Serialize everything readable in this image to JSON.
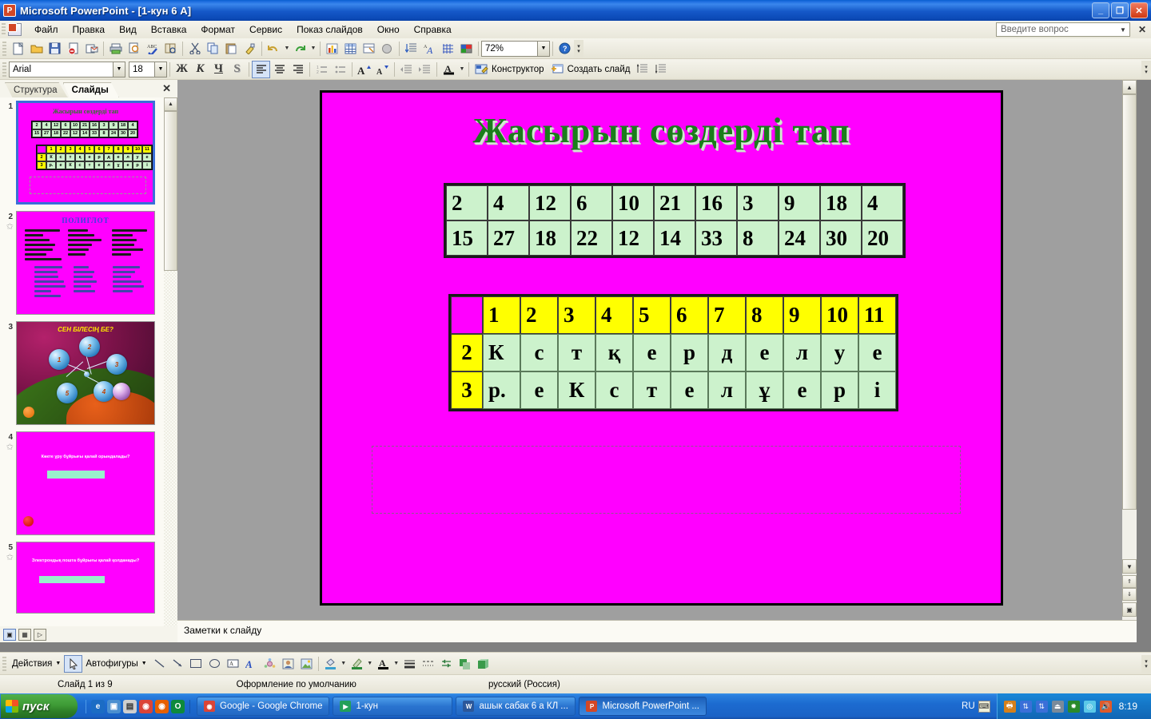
{
  "window": {
    "title": "Microsoft PowerPoint - [1-кун 6 А]",
    "app_icon": "powerpoint-icon",
    "minimize": "_",
    "restore": "❐",
    "close": "✕"
  },
  "menubar": {
    "items": [
      "Файл",
      "Правка",
      "Вид",
      "Вставка",
      "Формат",
      "Сервис",
      "Показ слайдов",
      "Окно",
      "Справка"
    ],
    "ask_placeholder": "Введите вопрос"
  },
  "standard_toolbar": {
    "buttons": [
      {
        "name": "new-document-icon",
        "glyph": "🗋"
      },
      {
        "name": "open-folder-icon",
        "glyph": "📂"
      },
      {
        "name": "save-icon",
        "glyph": "💾"
      },
      {
        "name": "permission-icon",
        "glyph": "🗎"
      },
      {
        "name": "email-icon",
        "glyph": "📧"
      },
      {
        "name": "print-icon",
        "glyph": "🖨"
      },
      {
        "name": "print-preview-icon",
        "glyph": "🔍"
      },
      {
        "name": "spelling-icon",
        "glyph": "ABC"
      },
      {
        "name": "research-icon",
        "glyph": "📖"
      },
      {
        "name": "cut-icon",
        "glyph": "✂"
      },
      {
        "name": "copy-icon",
        "glyph": "⧉"
      },
      {
        "name": "paste-icon",
        "glyph": "📋"
      },
      {
        "name": "format-painter-icon",
        "glyph": "🖌"
      },
      {
        "name": "undo-icon",
        "glyph": "↩"
      },
      {
        "name": "redo-icon",
        "glyph": "↪"
      },
      {
        "name": "insert-chart-icon",
        "glyph": "📊"
      },
      {
        "name": "insert-table-icon",
        "glyph": "▦"
      },
      {
        "name": "tables-borders-icon",
        "glyph": "▤"
      },
      {
        "name": "insert-hyperlink-icon",
        "glyph": "🌐"
      },
      {
        "name": "expand-all-icon",
        "glyph": "⇟"
      },
      {
        "name": "show-formatting-icon",
        "glyph": "A"
      },
      {
        "name": "show-grid-icon",
        "glyph": "▦"
      },
      {
        "name": "color-grayscale-icon",
        "glyph": "▨"
      }
    ],
    "zoom_value": "72%",
    "help_icon": "help-icon"
  },
  "formatting_toolbar": {
    "font_name": "Arial",
    "font_size": "18",
    "bold": "Ж",
    "italic": "К",
    "underline": "Ч",
    "shadow": "S",
    "align_left": "≡",
    "align_center": "≡",
    "align_right": "≡",
    "numbering": "≔",
    "bullets": "≔",
    "increase_font": "A",
    "decrease_font": "A",
    "decrease_indent": "⇤",
    "increase_indent": "⇥",
    "font_color": "A",
    "design_label": "Конструктор",
    "new_slide_label": "Создать слайд"
  },
  "task_pane": {
    "tab_outline": "Структура",
    "tab_slides": "Слайды",
    "active_tab": "Слайды",
    "close_icon": "close-icon",
    "slides": [
      {
        "number": "1",
        "selected": true,
        "has_star": false,
        "title": "Жасырын сөздерді тап"
      },
      {
        "number": "2",
        "selected": false,
        "has_star": true,
        "title": "ПОЛИГЛОТ"
      },
      {
        "number": "3",
        "selected": false,
        "has_star": false,
        "title": "СЕН БІЛЕСІҢ БЕ?"
      },
      {
        "number": "4",
        "selected": false,
        "has_star": true,
        "title": "Көкте ұру бұйрығы қалай орындалады?"
      },
      {
        "number": "5",
        "selected": false,
        "has_star": true,
        "title": "Электрондық пошта бұйрығы қалай қолданады?"
      }
    ]
  },
  "slide": {
    "title": "Жасырын сөздерді тап",
    "background_color": "#FF00FF",
    "title_color": "#1B7D1B",
    "number_table": {
      "cell_bg": "#CCF2CC",
      "rows": [
        [
          "2",
          "4",
          "12",
          "6",
          "10",
          "21",
          "16",
          "3",
          "9",
          "18",
          "4"
        ],
        [
          "15",
          "27",
          "18",
          "22",
          "12",
          "14",
          "33",
          "8",
          "24",
          "30",
          "20"
        ]
      ]
    },
    "letter_table": {
      "header_bg": "#FFFF00",
      "cell_bg": "#CCF2CC",
      "corner": "",
      "column_headers": [
        "1",
        "2",
        "3",
        "4",
        "5",
        "6",
        "7",
        "8",
        "9",
        "10",
        "11"
      ],
      "rows": [
        {
          "header": "2",
          "cells": [
            "К",
            "с",
            "т",
            "қ",
            "е",
            "р",
            "д",
            "е",
            "л",
            "у",
            "е"
          ]
        },
        {
          "header": "3",
          "cells": [
            "р.",
            "е",
            "К",
            "с",
            "т",
            "е",
            "л",
            "ұ",
            "е",
            "р",
            "і"
          ]
        }
      ]
    }
  },
  "notes": {
    "placeholder": "Заметки к слайду"
  },
  "drawing_toolbar": {
    "actions_label": "Действия",
    "autoshapes_label": "Автофигуры",
    "buttons": [
      {
        "name": "select-arrow-icon",
        "glyph": "↖"
      },
      {
        "name": "line-icon",
        "glyph": "╲"
      },
      {
        "name": "arrow-icon",
        "glyph": "↘"
      },
      {
        "name": "rectangle-icon",
        "glyph": "▭"
      },
      {
        "name": "oval-icon",
        "glyph": "◯"
      },
      {
        "name": "textbox-icon",
        "glyph": "A"
      },
      {
        "name": "wordart-icon",
        "glyph": "A"
      },
      {
        "name": "diagram-icon",
        "glyph": "❂"
      },
      {
        "name": "clipart-icon",
        "glyph": "▣"
      },
      {
        "name": "picture-icon",
        "glyph": "▨"
      },
      {
        "name": "fill-color-icon",
        "glyph": "🪣"
      },
      {
        "name": "line-color-icon",
        "glyph": "🖊"
      },
      {
        "name": "font-color-icon",
        "glyph": "A"
      },
      {
        "name": "line-style-icon",
        "glyph": "≡"
      },
      {
        "name": "dash-style-icon",
        "glyph": "┅"
      },
      {
        "name": "arrow-style-icon",
        "glyph": "⇄"
      },
      {
        "name": "shadow-style-icon",
        "glyph": "▪"
      },
      {
        "name": "3d-style-icon",
        "glyph": "▰"
      }
    ]
  },
  "statusbar": {
    "slide_counter": "Слайд 1 из 9",
    "design_name": "Оформление по умолчанию",
    "language": "русский (Россия)"
  },
  "taskbar": {
    "start_label": "пуск",
    "quick_launch": [
      {
        "name": "internet-explorer-icon",
        "glyph": "e",
        "color": "#1B6CC4"
      },
      {
        "name": "show-desktop-icon",
        "glyph": "▣",
        "color": "#4A8FD0"
      },
      {
        "name": "media-icon",
        "glyph": "▤",
        "color": "#C0C0C0"
      },
      {
        "name": "chrome-icon",
        "glyph": "◉",
        "color": "#DB4437"
      },
      {
        "name": "firefox-icon",
        "glyph": "◉",
        "color": "#E66000"
      },
      {
        "name": "opera-icon",
        "glyph": "O",
        "color": "#0E8A3C"
      }
    ],
    "tasks": [
      {
        "label": "Google - Google Chrome",
        "icon": "chrome-icon",
        "color": "#DB4437",
        "active": false
      },
      {
        "label": "1-кун",
        "icon": "powerpoint-show-icon",
        "color": "#22A05A",
        "active": false
      },
      {
        "label": "ашык сабак 6 а КЛ ...",
        "icon": "word-icon",
        "color": "#2B579A",
        "active": false
      },
      {
        "label": "Microsoft PowerPoint ...",
        "icon": "powerpoint-icon",
        "color": "#D24726",
        "active": true
      }
    ],
    "language_indicator": "RU",
    "keyboard_icon": "keyboard-icon",
    "tray_icons": [
      {
        "name": "printer-tray-icon",
        "glyph": "🖶",
        "color": "#D4801A"
      },
      {
        "name": "network-tray-icon",
        "glyph": "🖧",
        "color": "#3A6FD8"
      },
      {
        "name": "network2-tray-icon",
        "glyph": "🖧",
        "color": "#3A6FD8"
      },
      {
        "name": "usb-tray-icon",
        "glyph": "⏏",
        "color": "#888888"
      },
      {
        "name": "antivirus-tray-icon",
        "glyph": "✹",
        "color": "#2A8A2A"
      },
      {
        "name": "shield-tray-icon",
        "glyph": "◎",
        "color": "#5AC8E8"
      },
      {
        "name": "volume-tray-icon",
        "glyph": "🔊",
        "color": "#E05A2A"
      }
    ],
    "clock": "8:19"
  }
}
